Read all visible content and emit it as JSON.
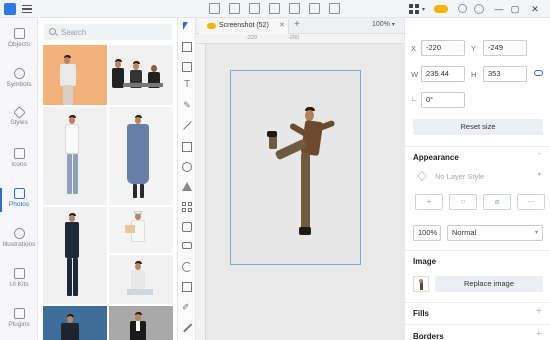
{
  "titlebar": {
    "grid_icon": "grid-icon",
    "cloud_color": "#f6b300",
    "controls": [
      "—",
      "▢",
      "✕"
    ]
  },
  "leftnav": {
    "items": [
      {
        "label": "Objects"
      },
      {
        "label": "Symbols"
      },
      {
        "label": "Styles"
      },
      {
        "label": "Icons"
      },
      {
        "label": "Photos"
      },
      {
        "label": "Illustrations"
      },
      {
        "label": "UI Kits"
      },
      {
        "label": "Plugins"
      }
    ],
    "active_index": 4,
    "accent": "#2c6fd6"
  },
  "photos": {
    "search_placeholder": "Search"
  },
  "tabs": {
    "current": "Screenshot (52)",
    "add": "+"
  },
  "canvas": {
    "zoom": "100%",
    "ruler_marks": [
      "-220",
      "-200"
    ]
  },
  "inspector": {
    "x_label": "X",
    "x_value": "-220",
    "y_label": "Y",
    "y_value": "-249",
    "w_label": "W",
    "w_value": "235.44",
    "h_label": "H",
    "h_value": "353",
    "rotation_value": "0°",
    "reset_size": "Reset size",
    "appearance_title": "Appearance",
    "layer_style": "No Layer Style",
    "opacity": "100%",
    "blend_mode": "Normal",
    "image_title": "Image",
    "replace_image": "Replace image",
    "fills_title": "Fills",
    "borders_title": "Borders",
    "add_symbol": "+"
  }
}
